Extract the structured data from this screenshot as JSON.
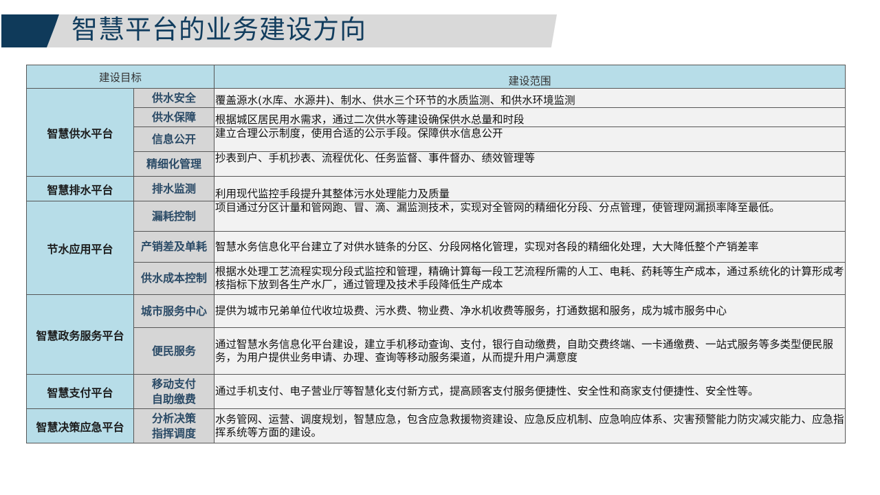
{
  "slide": {
    "title": "智慧平台的业务建设方向"
  },
  "table": {
    "headers": {
      "goal": "建设目标",
      "scope": "建设范围"
    },
    "groups": [
      {
        "platform": "智慧供水平台",
        "rows": [
          {
            "item": "供水安全",
            "desc": "覆盖源水(水库、水源井)、制水、供水三个环节的水质监测、和供水环境监测"
          },
          {
            "item": "供水保障",
            "desc": "根据城区居民用水需求，通过二次供水等建设确保供水总量和时段"
          },
          {
            "item": "信息公开",
            "desc": "建立合理公示制度，使用合适的公示手段。保障供水信息公开"
          },
          {
            "item": "精细化管理",
            "desc": "抄表到户、手机抄表、流程优化、任务监督、事件督办、绩效管理等"
          }
        ]
      },
      {
        "platform": "智慧排水平台",
        "rows": [
          {
            "item": "排水监测",
            "desc": "利用现代监控手段提升其整体污水处理能力及质量"
          }
        ]
      },
      {
        "platform": "节水应用平台",
        "rows": [
          {
            "item": "漏耗控制",
            "desc": "项目通过分区计量和管网跑、冒、滴、漏监测技术，实现对全管网的精细化分段、分点管理，使管理网漏损率降至最低。"
          },
          {
            "item": "产销差及单耗",
            "desc": "智慧水务信息化平台建立了对供水链条的分区、分段网格化管理，实现对各段的精细化处理，大大降低整个产销差率"
          },
          {
            "item": "供水成本控制",
            "desc": "根据水处理工艺流程实现分段式监控和管理，精确计算每一段工艺流程所需的人工、电耗、药耗等生产成本，通过系统化的计算形成考核指标下放到各生产水厂，通过管理及技术手段降低生产成本"
          }
        ]
      },
      {
        "platform": "智慧政务服务平台",
        "rows": [
          {
            "item": "城市服务中心",
            "desc": "提供为城市兄弟单位代收垃圾费、污水费、物业费、净水机收费等服务，打通数据和服务，成为城市服务中心"
          },
          {
            "item": "便民服务",
            "desc": "通过智慧水务信息化平台建设，建立手机移动查询、支付，银行自动缴费，自助交费终端、一卡通缴费、一站式服务等多类型便民服务，为用户提供业务申请、办理、查询等移动服务渠道，从而提升用户满意度"
          }
        ]
      },
      {
        "platform": "智慧支付平台",
        "rows": [
          {
            "item_line1": "移动支付",
            "item_line2": "自助缴费",
            "desc": "通过手机支付、电子营业厅等智慧化支付新方式，提高顾客支付服务便捷性、安全性和商家支付便捷性、安全性等。"
          }
        ]
      },
      {
        "platform": "智慧决策应急平台",
        "rows": [
          {
            "item_line1": "分析决策",
            "item_line2": "指挥调度",
            "desc": "水务管网、运营、调度规划，智慧应急，包含应急救援物资建设、应急反应机制、应急响应体系、灾害预警能力防灾减灾能力、应急指挥系统等方面的建设。"
          }
        ]
      }
    ]
  },
  "colors": {
    "title_text": "#123d5e",
    "banner_dark": "#0f3a5a",
    "banner_light": "#d9d9d9",
    "header_fill": "#b7dde8",
    "platform_fill": "#b7dde8",
    "item_fill": "#d6d6d6",
    "desc_fill": "#f2f2f2"
  }
}
